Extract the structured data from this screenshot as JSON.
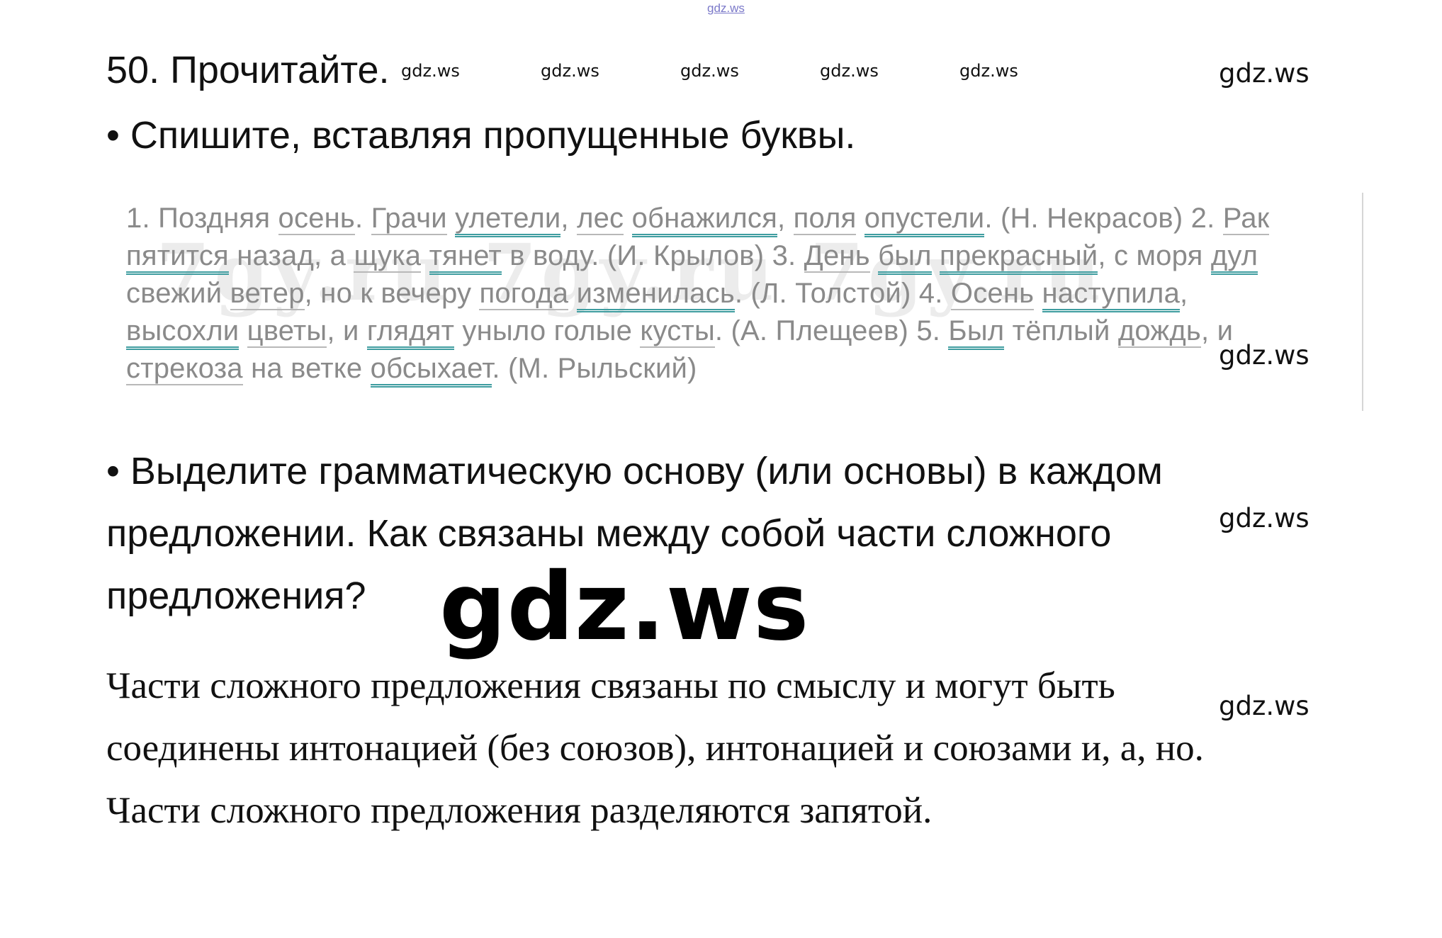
{
  "watermarks": {
    "top": "gdz.ws",
    "small": "gdz.ws",
    "big": "gdz.ws"
  },
  "task": {
    "title": "50. Прочитайте.",
    "bullet1": "• Спишите, вставляя пропущенные буквы.",
    "bullet2_lines": [
      "• Выделите грамматическую основу (или основы) в каждом",
      "предложении. Как связаны между собой части сложного",
      "предложения?"
    ]
  },
  "excerpt": {
    "background_watermark": "7gy.ru 7gy.ru 7gy.ru",
    "line1": [
      {
        "t": "1. Поздняя ",
        "s": "n"
      },
      {
        "t": "осень",
        "s": "u"
      },
      {
        "t": ". ",
        "s": "n"
      },
      {
        "t": "Грачи",
        "s": "u"
      },
      {
        "t": " ",
        "s": "n"
      },
      {
        "t": "улетели",
        "s": "uu"
      },
      {
        "t": ", ",
        "s": "n"
      },
      {
        "t": "лес",
        "s": "u"
      },
      {
        "t": " ",
        "s": "n"
      },
      {
        "t": "обнажился",
        "s": "uu"
      },
      {
        "t": ", ",
        "s": "n"
      },
      {
        "t": "поля",
        "s": "u"
      },
      {
        "t": " ",
        "s": "n"
      },
      {
        "t": "опустели",
        "s": "uu"
      },
      {
        "t": ". (Н. Некрасов) 2. ",
        "s": "n"
      },
      {
        "t": "Рак",
        "s": "u"
      }
    ],
    "line2": [
      {
        "t": "пятится",
        "s": "uu"
      },
      {
        "t": " назад, а ",
        "s": "n"
      },
      {
        "t": "щука",
        "s": "u"
      },
      {
        "t": " ",
        "s": "n"
      },
      {
        "t": "тянет",
        "s": "uu"
      },
      {
        "t": " в воду. (И. Крылов) 3. ",
        "s": "n"
      },
      {
        "t": "День",
        "s": "u"
      },
      {
        "t": " ",
        "s": "n"
      },
      {
        "t": "был",
        "s": "uu"
      },
      {
        "t": " ",
        "s": "n"
      },
      {
        "t": "прекрасный",
        "s": "uu"
      },
      {
        "t": ", с моря ",
        "s": "n"
      },
      {
        "t": "дул",
        "s": "uu"
      }
    ],
    "line3": [
      {
        "t": "свежий ",
        "s": "n"
      },
      {
        "t": "ветер",
        "s": "u"
      },
      {
        "t": ", но к вечеру ",
        "s": "n"
      },
      {
        "t": "погода",
        "s": "u"
      },
      {
        "t": " ",
        "s": "n"
      },
      {
        "t": "изменилась",
        "s": "uu"
      },
      {
        "t": ". (Л. Толстой) 4. ",
        "s": "n"
      },
      {
        "t": "Осень",
        "s": "u"
      },
      {
        "t": " ",
        "s": "n"
      },
      {
        "t": "наступила",
        "s": "uu"
      },
      {
        "t": ",",
        "s": "n"
      }
    ],
    "line4": [
      {
        "t": "высохли",
        "s": "uu"
      },
      {
        "t": " ",
        "s": "n"
      },
      {
        "t": "цветы",
        "s": "u"
      },
      {
        "t": ", и ",
        "s": "n"
      },
      {
        "t": "глядят",
        "s": "uu"
      },
      {
        "t": " уныло голые ",
        "s": "n"
      },
      {
        "t": "кусты",
        "s": "u"
      },
      {
        "t": ". (А. Плещеев) 5. ",
        "s": "n"
      },
      {
        "t": "Был",
        "s": "uu"
      },
      {
        "t": " тёплый ",
        "s": "n"
      },
      {
        "t": "дождь",
        "s": "u"
      },
      {
        "t": ", и",
        "s": "n"
      }
    ],
    "line5": [
      {
        "t": "стрекоза",
        "s": "u"
      },
      {
        "t": " на ветке ",
        "s": "n"
      },
      {
        "t": "обсыхает",
        "s": "uu"
      },
      {
        "t": ". (М. Рыльский)",
        "s": "n"
      }
    ]
  },
  "answer": {
    "lines": [
      "Части сложного предложения связаны по смыслу и могут быть",
      "соединены интонацией (без союзов),  интонацией и союзами и, а, но.",
      "Части сложного предложения разделяются запятой."
    ]
  }
}
